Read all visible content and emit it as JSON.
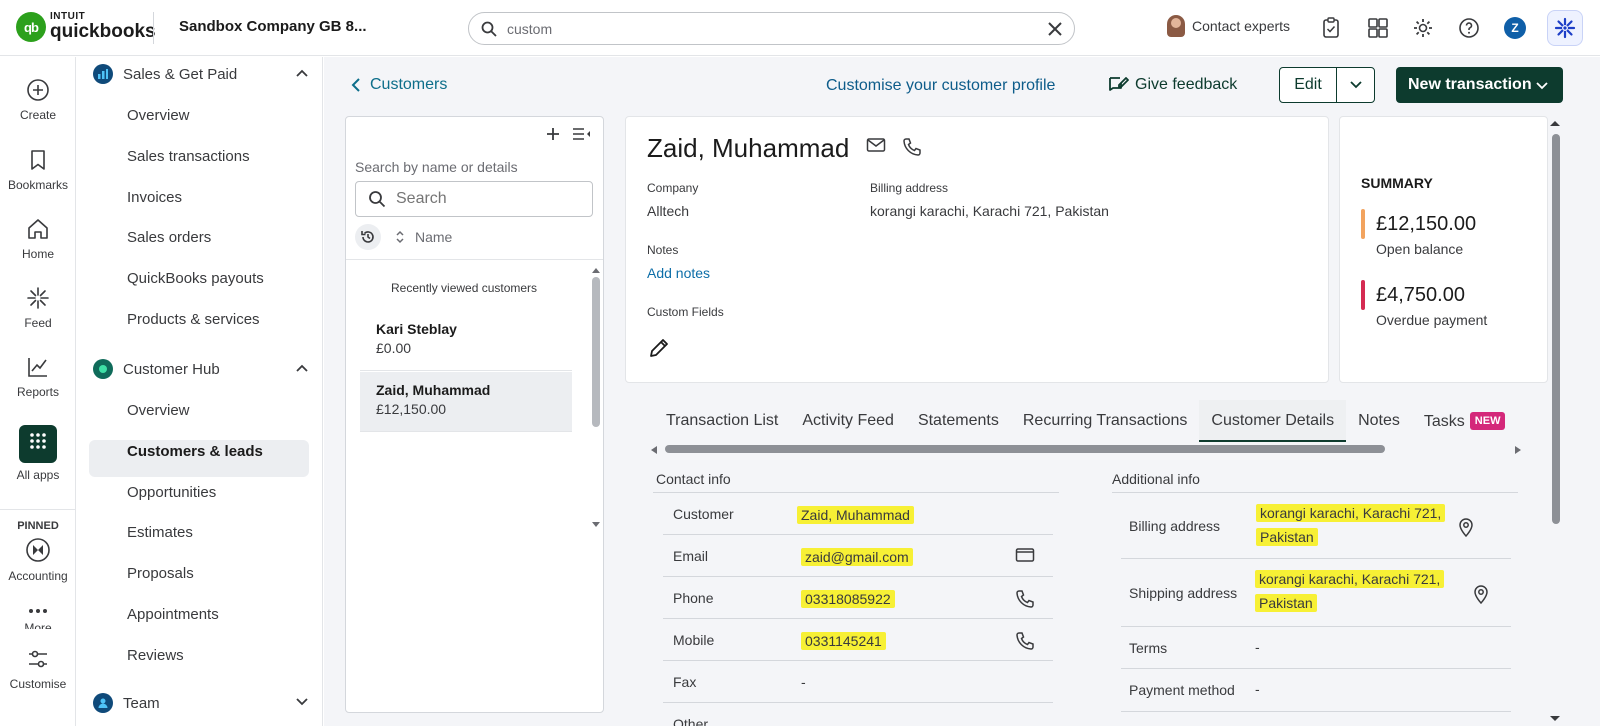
{
  "topbar": {
    "logo_intuit": "INTUIT",
    "logo_qb": "quickbooks",
    "company": "Sandbox Company GB 8...",
    "search_value": "custom",
    "contact_experts": "Contact experts",
    "user_initial": "Z"
  },
  "rail": {
    "create": "Create",
    "bookmarks": "Bookmarks",
    "home": "Home",
    "feed": "Feed",
    "reports": "Reports",
    "all_apps": "All apps",
    "pinned": "PINNED",
    "accounting": "Accounting",
    "more": "More",
    "customise": "Customise"
  },
  "sidenav": {
    "sales_head": "Sales & Get Paid",
    "sales_items": [
      "Overview",
      "Sales transactions",
      "Invoices",
      "Sales orders",
      "QuickBooks payouts",
      "Products & services"
    ],
    "hub_head": "Customer Hub",
    "hub_items": [
      "Overview",
      "Customers & leads",
      "Opportunities",
      "Estimates",
      "Proposals",
      "Appointments",
      "Reviews"
    ],
    "team_head": "Team"
  },
  "header": {
    "back": "Customers",
    "customise_profile": "Customise your customer profile",
    "feedback": "Give feedback",
    "edit": "Edit",
    "new_transaction": "New transaction"
  },
  "list": {
    "hint": "Search by name or details",
    "search_placeholder": "Search",
    "sort_label": "Name",
    "recent_label": "Recently viewed customers",
    "customers": [
      {
        "name": "Kari Steblay",
        "balance": "£0.00"
      },
      {
        "name": "Zaid, Muhammad",
        "balance": "£12,150.00"
      }
    ]
  },
  "detail": {
    "name": "Zaid, Muhammad",
    "company_label": "Company",
    "company": "Alltech",
    "billing_label": "Billing address",
    "billing": "korangi karachi, Karachi 721, Pakistan",
    "notes_label": "Notes",
    "add_notes": "Add notes",
    "custom_fields_label": "Custom Fields"
  },
  "summary": {
    "title": "SUMMARY",
    "open_amount": "£12,150.00",
    "open_label": "Open balance",
    "overdue_amount": "£4,750.00",
    "overdue_label": "Overdue payment",
    "colors": {
      "open": "#f2a35e",
      "overdue": "#d52b52"
    }
  },
  "tabs": [
    "Transaction List",
    "Activity Feed",
    "Statements",
    "Recurring Transactions",
    "Customer Details",
    "Notes",
    "Tasks"
  ],
  "tab_badge": "NEW",
  "contact_info": {
    "title": "Contact info",
    "rows": [
      {
        "label": "Customer",
        "value": "Zaid, Muhammad"
      },
      {
        "label": "Email",
        "value": "zaid@gmail.com"
      },
      {
        "label": "Phone",
        "value": "03318085922"
      },
      {
        "label": "Mobile",
        "value": "0331145241"
      },
      {
        "label": "Fax",
        "value": "-"
      },
      {
        "label": "Other",
        "value": ""
      }
    ]
  },
  "additional_info": {
    "title": "Additional info",
    "billing_label": "Billing address",
    "billing_line1": "korangi karachi, Karachi 721,",
    "billing_line2": "Pakistan",
    "shipping_label": "Shipping address",
    "shipping_line1": "korangi karachi, Karachi 721,",
    "shipping_line2": "Pakistan",
    "terms_label": "Terms",
    "terms": "-",
    "payment_label": "Payment method",
    "payment": "-"
  },
  "colors": {
    "brand_green": "#2ca01c",
    "dark_green": "#0d3b2e",
    "highlight": "#f7f035",
    "link": "#0d6ea8"
  }
}
